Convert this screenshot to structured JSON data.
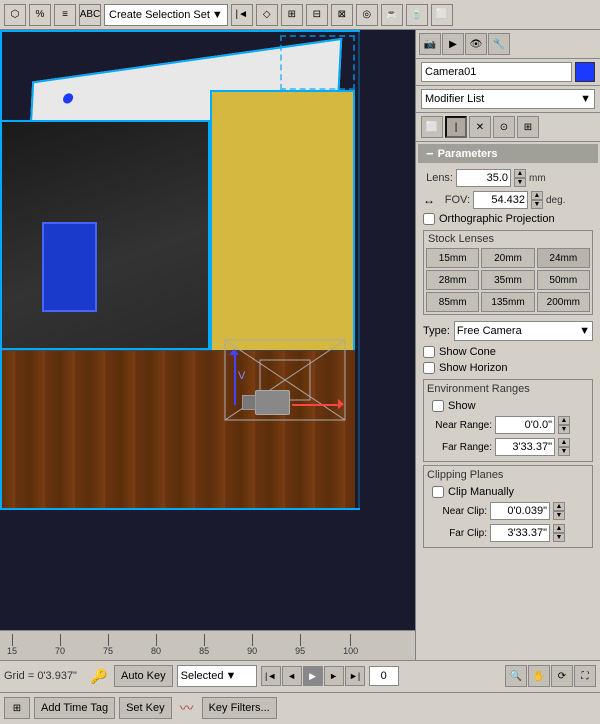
{
  "toolbar": {
    "selection_label": "Create Selection Set",
    "dropdown_arrow": "▼"
  },
  "right_panel": {
    "camera_name": "Camera01",
    "modifier_list": "Modifier List",
    "params_title": "Parameters",
    "lens_label": "Lens:",
    "lens_value": "35.0",
    "lens_unit": "mm",
    "fov_label": "FOV:",
    "fov_value": "54.432",
    "fov_unit": "deg.",
    "ortho_label": "Orthographic Projection",
    "stock_lenses_label": "Stock Lenses",
    "lenses": [
      "15mm",
      "20mm",
      "24mm",
      "28mm",
      "35mm",
      "50mm",
      "85mm",
      "135mm",
      "200mm"
    ],
    "type_label": "Type:",
    "type_value": "Free Camera",
    "show_cone_label": "Show Cone",
    "show_horizon_label": "Show Horizon",
    "env_ranges_label": "Environment Ranges",
    "env_show_label": "Show",
    "near_range_label": "Near Range:",
    "near_range_value": "0'0.0\"",
    "far_range_label": "Far Range:",
    "far_range_value": "3'33.37\"",
    "clip_planes_label": "Clipping Planes",
    "clip_manually_label": "Clip Manually",
    "near_clip_label": "Near Clip:",
    "near_clip_value": "0'0.039\"",
    "far_clip_label": "Far Clip:",
    "far_clip_value": "3'33.37\""
  },
  "ruler": {
    "marks": [
      "15",
      "70",
      "75",
      "80",
      "85",
      "90",
      "95",
      "100"
    ],
    "values": [
      15,
      70,
      75,
      80,
      85,
      90,
      95,
      100
    ]
  },
  "bottom": {
    "grid_label": "Grid = 0'3.937\"",
    "key_symbol": "🔑",
    "auto_key": "Auto Key",
    "selected": "Selected",
    "frame_value": "0",
    "set_key": "Set Key",
    "key_filters": "Key Filters...",
    "add_time_tag": "Add Time Tag"
  }
}
